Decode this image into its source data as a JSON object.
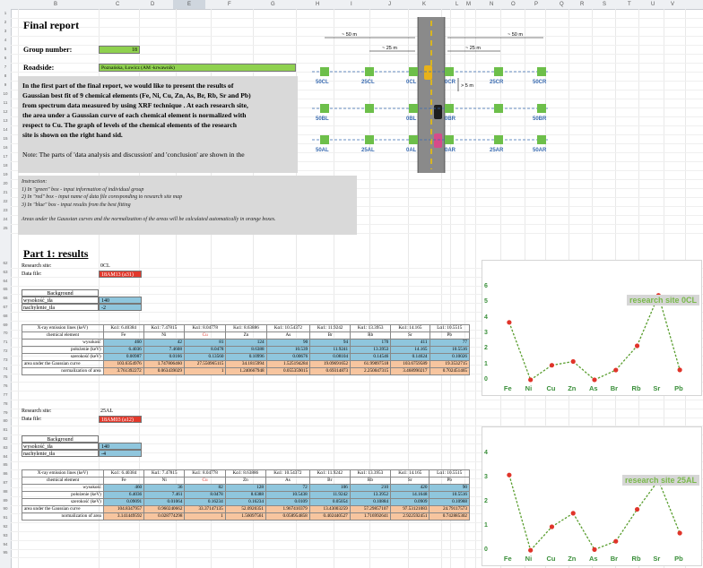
{
  "sheet": {
    "columns": [
      "B",
      "C",
      "D",
      "E",
      "F",
      "G",
      "H",
      "I",
      "J",
      "K",
      "L",
      "M",
      "N",
      "O",
      "P",
      "Q",
      "R",
      "S",
      "T",
      "U",
      "V"
    ],
    "selected_column": "E",
    "rows": [
      "1",
      "2",
      "3",
      "4",
      "5",
      "6",
      "7",
      "8",
      "9",
      "10",
      "11",
      "12",
      "13",
      "14",
      "15",
      "16",
      "17",
      "18",
      "19",
      "20",
      "21",
      "22",
      "23",
      "24",
      "25",
      "62",
      "63",
      "64",
      "65",
      "66",
      "67",
      "68",
      "69",
      "70",
      "71",
      "72",
      "73",
      "74",
      "75",
      "76",
      "77",
      "78",
      "79",
      "80",
      "81",
      "82",
      "83",
      "84",
      "85",
      "86",
      "87",
      "88",
      "89",
      "90",
      "91",
      "92",
      "93",
      "94",
      "95"
    ]
  },
  "report": {
    "title": "Final report",
    "group_label": "Group number:",
    "group_value": "18",
    "roadside_label": "Roadside:",
    "roadside_value": "Poznańska, Łowicz (AM -krwawnik)",
    "intro_lines": [
      "In the first part of the final report, we would like to present the results of",
      "Gaussian best fit of 9 chemical elements (Fe, Ni, Cu, Zn,  As, Br, Rb, Sr and Pb)",
      "from spectrum data measured by using XRF technique . At each research site,",
      "the area under a Gaussian curve of each chemical element is normalized with",
      "respect to Cu. The graph of levels of the chemical elements of the research",
      "site is shown on the right hand sid."
    ],
    "note": "Note: The parts of 'data analysis and discussion' and 'conclusion' are shown in the"
  },
  "instruction": {
    "title": "Instruction:",
    "lines": [
      "1) In \"green\" box - input information of individual group",
      "2) In \"red\" box - input name of data file coresponding to research site map",
      "3) In \"blue\" box - input results from the best fitting"
    ],
    "footer": "Areas under the Gaussian curves and the normalization of the areas will be calculated automatically in orange boxes."
  },
  "map": {
    "dist_50_left": "~ 50 m",
    "dist_25_left": "~ 25 m",
    "dist_50_right": "~ 50 m",
    "dist_25_right": "~ 25 m",
    "dist_5": "> 5 m",
    "row1": [
      "50CL",
      "25CL",
      "0CL",
      "0CR",
      "25CR",
      "50CR"
    ],
    "row2": [
      "50BL",
      "",
      "0BL",
      "0BR",
      "",
      "50BR"
    ],
    "row3": [
      "50AL",
      "25AL",
      "0AL",
      "0AR",
      "25AR",
      "50AR"
    ]
  },
  "part1": {
    "title": "Part 1: results"
  },
  "site1": {
    "site_label": "Research site:",
    "site_value": "0CL",
    "file_label": "Data file:",
    "file_value": "18AM13 (a31)",
    "background": "Background",
    "wys_label": "wysokość_tła",
    "wys_value": "140",
    "nach_label": "nachylenie_tła",
    "nach_value": "-2",
    "headers": [
      "X-ray emission lines (keV)",
      "Kα1: 6.40384",
      "Kα1: 7.47815",
      "Kα1: 8.04778",
      "Kα1: 8.63886",
      "Kα1: 10.54372",
      "Kα1: 11.9242",
      "Kα1: 13.3953",
      "Kα1: 14.165",
      "Lα1: 10.5515"
    ],
    "elements": [
      "chemical element",
      "Fe",
      "Ni",
      "Cu",
      "Zn",
      "As",
      "Br",
      "Rb",
      "Sr",
      "Pb"
    ],
    "rows": [
      {
        "label": "wysokość",
        "values": [
          "460",
          "42",
          "81",
          "124",
          "90",
          "94",
          "170",
          "411",
          "77"
        ]
      },
      {
        "label": "położenie (keV)",
        "values": [
          "6.4036",
          "7.4608",
          "8.0478",
          "8.6388",
          "10.539",
          "11.9241",
          "13.3953",
          "14.165",
          "10.5516"
        ]
      },
      {
        "label": "szerokość (keV)",
        "values": [
          "0.00987",
          "0.0166",
          "0.13560",
          "0.10996",
          "0.00676",
          "0.08104",
          "0.14546",
          "0.14624",
          "0.10026"
        ]
      }
    ],
    "area_label": "area under the Gaussian curve",
    "area": [
      "103.6354976",
      "1.747806460",
      "27.550965115",
      "34.1815994",
      "1.525194284",
      "19.09691652",
      "61.99097518",
      "103.6759589",
      "19.3532715"
    ],
    "norm_label": "normalization of area",
    "norm": [
      "3.761392272",
      "0.063439029",
      "1",
      "1.240667948",
      "0.055359015",
      "0.69314873",
      "2.250047315",
      "3.468990217",
      "0.702451465"
    ]
  },
  "site2": {
    "site_label": "Research site:",
    "site_value": "25AL",
    "file_label": "Data file:",
    "file_value": "18AM03 (a12)",
    "background": "Background",
    "wys_label": "wysokość_tła",
    "wys_value": "140",
    "nach_label": "nachylenie_tła",
    "nach_value": "-4",
    "headers": [
      "X-ray emission lines (keV)",
      "Kα1: 6.40384",
      "Kα1: 7.47815",
      "Kα1: 8.04778",
      "Kα1: 8.63886",
      "Kα1: 10.54372",
      "Kα1: 11.9242",
      "Kα1: 13.3953",
      "Kα1: 14.165",
      "Lα1: 10.5515"
    ],
    "elements": [
      "chemical element",
      "Fe",
      "Ni",
      "Cu",
      "Zn",
      "As",
      "Br",
      "Rb",
      "Sr",
      "Pb"
    ],
    "rows": [
      {
        "label": "wysokość",
        "values": [
          "460",
          "36",
          "82",
          "128",
          "72",
          "106",
          "210",
          "420",
          "90"
        ]
      },
      {
        "label": "położenie (keV)",
        "values": [
          "6.4036",
          "7.461",
          "8.0478",
          "8.6388",
          "10.5438",
          "11.9242",
          "13.3952",
          "14.1648",
          "10.5516"
        ]
      },
      {
        "label": "szerokość (keV)",
        "values": [
          "0.09091",
          "0.01064",
          "0.16234",
          "0.16234",
          "0.0109",
          "0.05054",
          "0.10884",
          "0.0909",
          "0.10988"
        ]
      }
    ],
    "area_label": "area under the Gaussian curve",
    "area": [
      "104.8347957",
      "0.960240662",
      "33.37147135",
      "52.0920351",
      "1.967410379",
      "13.43003259",
      "57.29857107",
      "97.53121083",
      "24.79117573"
    ],
    "norm_label": "normalization of area",
    "norm": [
      "3.141449592",
      "0.028774298",
      "1",
      "1.56097561",
      "0.058954858",
      "0.402440527",
      "1.716992641",
      "2.922592451",
      "0.742885302"
    ]
  },
  "chart_data": [
    {
      "type": "line",
      "title": "research site 0CL",
      "categories": [
        "Fe",
        "Ni",
        "Cu",
        "Zn",
        "As",
        "Br",
        "Rb",
        "Sr",
        "Pb"
      ],
      "series": [
        {
          "values": [
            3.76,
            0.06,
            1.0,
            1.24,
            0.06,
            0.69,
            2.25,
            5.5,
            0.7
          ]
        }
      ],
      "ylim": [
        0,
        6
      ],
      "yticks": [
        "0",
        "1",
        "2",
        "3",
        "4",
        "5",
        "6"
      ],
      "grid": false,
      "colors": {
        "line": "#5a9e2f",
        "point": "#e0342a"
      }
    },
    {
      "type": "line",
      "title": "research site 25AL",
      "categories": [
        "Fe",
        "Ni",
        "Cu",
        "Zn",
        "As",
        "Br",
        "Rb",
        "Sr",
        "Pb"
      ],
      "series": [
        {
          "values": [
            3.14,
            0.03,
            1.0,
            1.56,
            0.06,
            0.4,
            1.72,
            2.92,
            0.74
          ]
        }
      ],
      "ylim": [
        0,
        4
      ],
      "yticks": [
        "0",
        "1",
        "2",
        "3",
        "4"
      ],
      "grid": false,
      "colors": {
        "line": "#5a9e2f",
        "point": "#e0342a"
      }
    }
  ]
}
